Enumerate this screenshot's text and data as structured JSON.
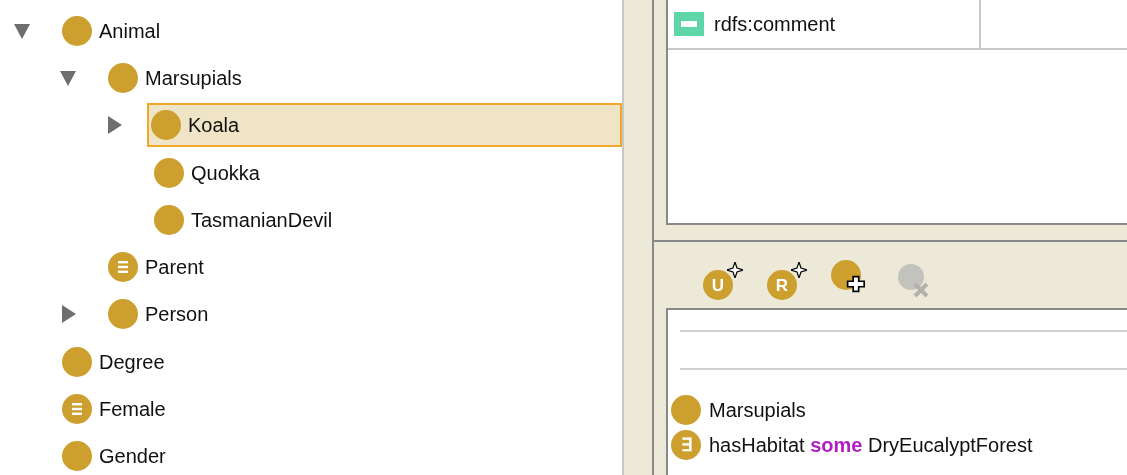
{
  "class_tree": [
    {
      "label": "Animal",
      "kind": "class",
      "expanded": true,
      "selected": false,
      "children": [
        {
          "label": "Marsupials",
          "kind": "class",
          "expanded": true,
          "selected": false,
          "children": [
            {
              "label": "Koala",
              "kind": "class",
              "expanded": false,
              "selected": true
            },
            {
              "label": "Quokka",
              "kind": "class",
              "selected": false
            },
            {
              "label": "TasmanianDevil",
              "kind": "class",
              "selected": false
            }
          ]
        },
        {
          "label": "Parent",
          "kind": "defined",
          "selected": false
        },
        {
          "label": "Person",
          "kind": "class",
          "expanded": false,
          "selected": false
        }
      ]
    },
    {
      "label": "Degree",
      "kind": "class",
      "selected": false
    },
    {
      "label": "Female",
      "kind": "defined",
      "selected": false
    },
    {
      "label": "Gender",
      "kind": "class",
      "selected": false
    }
  ],
  "annotations": {
    "rows": [
      {
        "property": "rdfs:comment"
      }
    ]
  },
  "toolbar": [
    {
      "kind": "union",
      "glyph": "U",
      "disabled": false
    },
    {
      "kind": "restriction",
      "glyph": "R",
      "disabled": false
    },
    {
      "kind": "add_class",
      "disabled": false
    },
    {
      "kind": "remove",
      "disabled": true
    }
  ],
  "superclasses": [
    {
      "kind": "class",
      "label": "Marsupials"
    },
    {
      "kind": "restriction",
      "glyph": "∃",
      "property": "hasHabitat",
      "quantifier": "some",
      "filler": "DryEucalyptForest"
    }
  ]
}
